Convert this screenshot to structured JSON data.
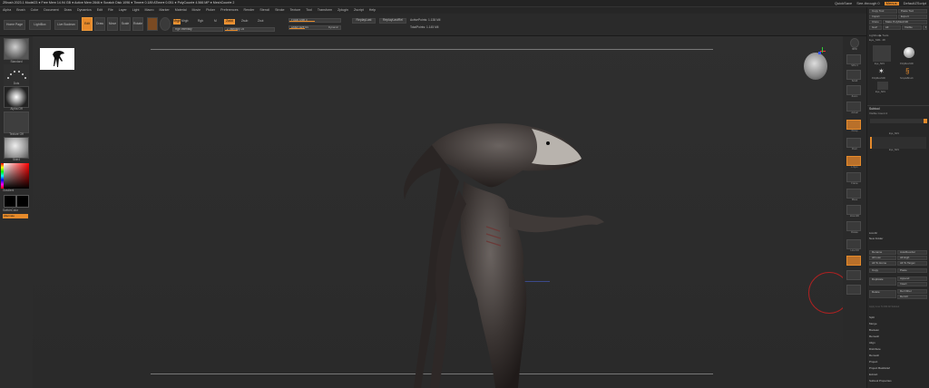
{
  "titlebar": {
    "text": "ZBrush 2023.1   Model23   ● Free Mem 14.94 GB ● Active Mem 2846 ● Scratch Disk 1096 ● Timer● 0.189 ATime● 0.051 ● PolyCount● 4.566 MP ● MeshCount● 2",
    "quicksave": "QuickSave",
    "seethrough": "See-through  0",
    "menus": "Menus",
    "defaultscript": "DefaultZScript"
  },
  "menubar": [
    "Alpha",
    "Brush",
    "Color",
    "Document",
    "Draw",
    "Dynamics",
    "Edit",
    "File",
    "Layer",
    "Light",
    "Macro",
    "Marker",
    "Material",
    "Movie",
    "Picker",
    "Preferences",
    "Render",
    "Stencil",
    "Stroke",
    "Texture",
    "Tool",
    "Transform",
    "Zplugin",
    "Zscript",
    "Help"
  ],
  "toolbar": {
    "home_page": "Home Page",
    "lightbox": "LightBox",
    "live_boolean": "Live Boolean",
    "edit": "Edit",
    "draw": "Draw",
    "move": "Move",
    "scale": "Scale",
    "rotate": "Rotate",
    "mrgb": "Mrgb",
    "rgb": "Rgb",
    "m": "M",
    "zadd": "Zadd",
    "zsub": "Zsub",
    "zcut": "Zcut",
    "rgb_intensity": "Rgb Intensity",
    "z_intensity": "Z Intensity  25",
    "focal_shift": "Focal Shift  0",
    "draw_size": "Draw Size  64",
    "dynamic": "Dynamic",
    "replay_last": "ReplayLast",
    "replay_last_rel": "ReplayLastRel",
    "active_points": "ActivePoints: 1.138 Mil",
    "total_points": "TotalPoints: 1.145 Mil"
  },
  "lefttray": {
    "brush": "Standard",
    "stroke": "Dots",
    "alpha": "Alpha Off",
    "texture": "Texture Off",
    "material": "Skin4",
    "gradient": "Gradient",
    "switch_color": "SwitchColor",
    "alternate": "Alternate"
  },
  "righticons": [
    "BPR",
    "SPix 3",
    "Scroll",
    "Zoom",
    "Actual",
    "AAHalf",
    "Persp",
    "Floor",
    "Local",
    "L.Sym",
    "Frame",
    "Move",
    "Zoom3D",
    "Rotate",
    "Line Fill",
    "PolyF",
    "Transp",
    "Ghost",
    "Solo",
    "Xpose"
  ],
  "rightpanel": {
    "top_buttons": [
      "Copy Tool",
      "Paste Tool",
      "Import",
      "Export",
      "Clone",
      "Make PolyMesh3D",
      "GoZ",
      "All",
      "Visible",
      "R"
    ],
    "lightbox_tools": "Lightbox▶ Tools",
    "current_tool": "Eye_SR1. 48",
    "tools": [
      "Eye_SR1",
      "PolyMesh3D",
      "PolyMesh3D",
      "SimpleBrush",
      "Eye_SR1"
    ],
    "subtool_head": "Subtool",
    "visible_count": "Visible Count 2",
    "subtool_item": "Eye_SR1",
    "subtool_item2": "Eye_SR1",
    "list_all": "List All",
    "new_folder": "New Folder",
    "actions": [
      [
        "Rename",
        "AutoReorder"
      ],
      [
        "All Low",
        "All High"
      ],
      [
        "All To Home",
        "All To Target"
      ],
      [
        "Copy",
        "Paste"
      ],
      [
        "Duplicate",
        "Append"
      ],
      [
        "",
        "Insert"
      ],
      [
        "Delete",
        "Del Other"
      ],
      [
        "",
        "Del All"
      ]
    ],
    "split_note": "Apply Line To NM All Subtool",
    "sections": [
      "Split",
      "Merge",
      "Boolean",
      "Remesh",
      "Align",
      "Distribute",
      "Remesh",
      "Project",
      "Project BasRelief",
      "Extract",
      "Subtool Properties"
    ]
  },
  "colors": {
    "accent": "#e58a2b",
    "bg": "#2c2c2c"
  }
}
